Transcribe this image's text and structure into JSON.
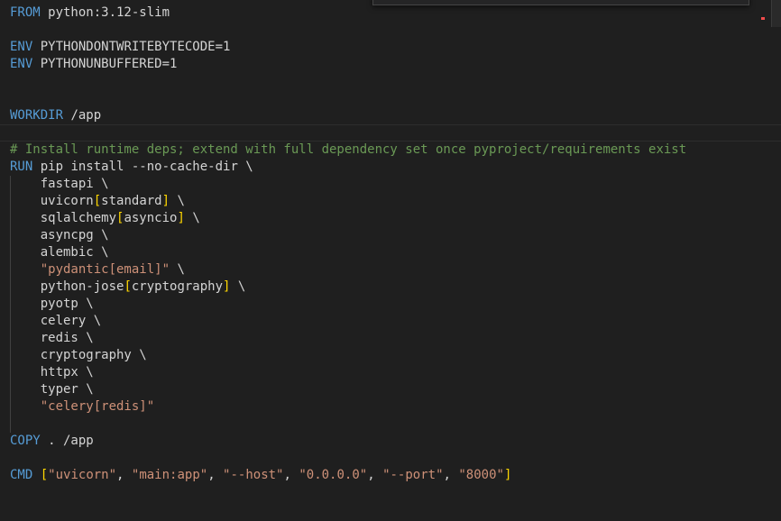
{
  "lines": [
    {
      "kind": "instr",
      "kw": "FROM",
      "rest": " python:3.12-slim"
    },
    {
      "kind": "empty"
    },
    {
      "kind": "instr",
      "kw": "ENV",
      "rest": " PYTHONDONTWRITEBYTECODE=1"
    },
    {
      "kind": "instr",
      "kw": "ENV",
      "rest": " PYTHONUNBUFFERED=1"
    },
    {
      "kind": "empty"
    },
    {
      "kind": "empty"
    },
    {
      "kind": "instr",
      "kw": "WORKDIR",
      "rest": " /app"
    },
    {
      "kind": "empty",
      "current": true
    },
    {
      "kind": "comment",
      "text": "# Install runtime deps; extend with full dependency set once pyproject/requirements exist"
    },
    {
      "kind": "instr",
      "kw": "RUN",
      "rest": " pip install --no-cache-dir \\"
    },
    {
      "kind": "pkg",
      "name": "fastapi"
    },
    {
      "kind": "pkg",
      "name": "uvicorn",
      "extra": "standard"
    },
    {
      "kind": "pkg",
      "name": "sqlalchemy",
      "extra": "asyncio"
    },
    {
      "kind": "pkg",
      "name": "asyncpg"
    },
    {
      "kind": "pkg",
      "name": "alembic"
    },
    {
      "kind": "pkgstr",
      "text": "\"pydantic[email]\""
    },
    {
      "kind": "pkg",
      "name": "python-jose",
      "extra": "cryptography"
    },
    {
      "kind": "pkg",
      "name": "pyotp"
    },
    {
      "kind": "pkg",
      "name": "celery"
    },
    {
      "kind": "pkg",
      "name": "redis"
    },
    {
      "kind": "pkg",
      "name": "cryptography"
    },
    {
      "kind": "pkg",
      "name": "httpx"
    },
    {
      "kind": "pkg",
      "name": "typer"
    },
    {
      "kind": "pkgstr",
      "text": "\"celery[redis]\"",
      "last": true
    },
    {
      "kind": "empty"
    },
    {
      "kind": "instr",
      "kw": "COPY",
      "rest": " . /app"
    },
    {
      "kind": "empty"
    },
    {
      "kind": "cmd",
      "kw": "CMD",
      "args": [
        "\"uvicorn\"",
        "\"main:app\"",
        "\"--host\"",
        "\"0.0.0.0\"",
        "\"--port\"",
        "\"8000\""
      ]
    }
  ],
  "colors": {
    "keyword": "#569cd6",
    "comment": "#6a9955",
    "bracket": "#ffd700",
    "string": "#ce9178",
    "text": "#d4d4d4",
    "background": "#1f1f1f"
  }
}
